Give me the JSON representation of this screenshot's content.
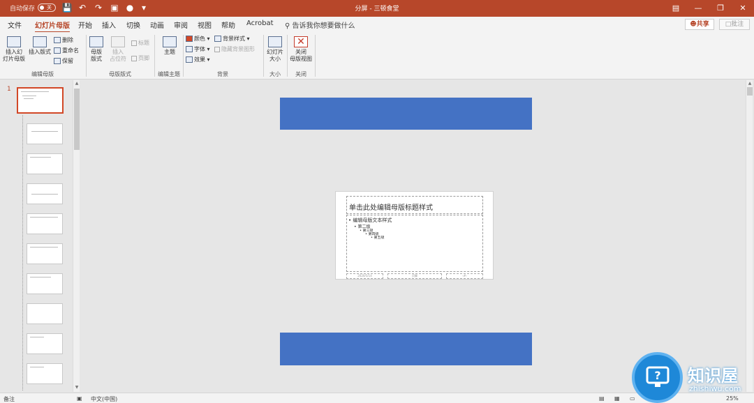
{
  "titlebar": {
    "autosave_label": "自动保存",
    "autosave_state": "关",
    "title": "分屏 - 三顿食堂"
  },
  "menu": {
    "tabs": [
      "文件",
      "幻灯片母版",
      "开始",
      "插入",
      "切换",
      "动画",
      "审阅",
      "视图",
      "帮助",
      "Acrobat"
    ],
    "active_tab": "幻灯片母版",
    "tell_me": "告诉我你想要做什么",
    "share": "共享",
    "comment": "批注"
  },
  "ribbon": {
    "insert_master": "插入幻\n灯片母版",
    "insert_master_l1": "插入幻",
    "insert_master_l2": "灯片母版",
    "insert_layout": "插入版式",
    "delete": "删除",
    "rename": "重命名",
    "preserve": "保留",
    "master_layout_l1": "母版",
    "master_layout_l2": "版式",
    "insert_placeholder_l1": "插入",
    "insert_placeholder_l2": "占位符",
    "title_chk": "标题",
    "footer_chk": "页脚",
    "theme": "主题",
    "colors": "颜色",
    "fonts": "字体",
    "effects": "效果",
    "bg_styles": "背景样式",
    "hide_bg": "隐藏背景图形",
    "slide_size_l1": "幻灯片",
    "slide_size_l2": "大小",
    "close_l1": "关闭",
    "close_l2": "母版视图",
    "groups": {
      "edit_master": "编辑母版",
      "master_layout": "母版版式",
      "edit_theme": "编辑主题",
      "background": "背景",
      "size": "大小",
      "close": "关闭"
    }
  },
  "thumbnails": {
    "slide_number": "1",
    "count": 10
  },
  "slide": {
    "title": "单击此处编辑母版标题样式",
    "levels": [
      "编辑母版文本样式",
      "第二级",
      "第三级",
      "第四级",
      "第五级"
    ],
    "footer_date": "2020/5/14",
    "footer_mid": "页脚",
    "footer_num": "‹#›"
  },
  "colors": {
    "accent": "#b7472a",
    "bluebar": "#4472c4"
  },
  "statusbar": {
    "notes": "备注",
    "language": "中文(中国)",
    "zoom": "25%"
  },
  "watermark": {
    "text": "知识屋",
    "url": "zhishiwu.com"
  }
}
